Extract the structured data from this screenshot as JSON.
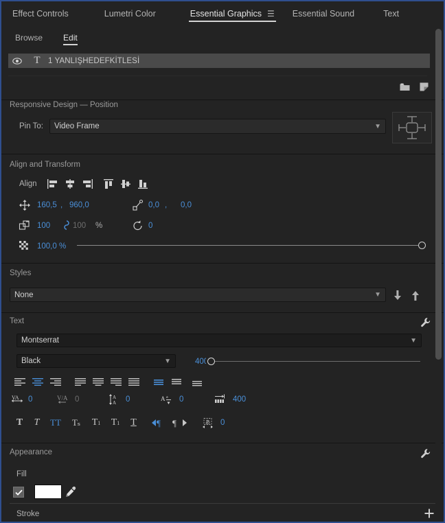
{
  "window": {
    "title": "Essential Graphics"
  },
  "tabs": [
    {
      "label": "Effect Controls",
      "active": false
    },
    {
      "label": "Lumetri Color",
      "active": false
    },
    {
      "label": "Essential Graphics",
      "active": true
    },
    {
      "label": "Essential Sound",
      "active": false
    },
    {
      "label": "Text",
      "active": false
    }
  ],
  "subtabs": [
    {
      "label": "Browse",
      "active": false
    },
    {
      "label": "Edit",
      "active": true
    }
  ],
  "layer": {
    "name": "1 YANLIŞHEDEFKİTLESİ",
    "visibility_icon": "eye-icon",
    "type_icon": "text-layer-icon"
  },
  "layer_toolbar": {
    "folder_icon": "new-folder-icon",
    "new_layer_icon": "new-layer-icon"
  },
  "responsive": {
    "title": "Responsive Design — Position",
    "pin_label": "Pin To:",
    "pin_value": "Video Frame",
    "pin_options": [
      "Video Frame"
    ]
  },
  "align_transform": {
    "title": "Align and Transform",
    "align_label": "Align",
    "align_buttons": [
      "align-left-icon",
      "align-center-horizontal-icon",
      "align-right-icon",
      "align-top-icon",
      "align-center-vertical-icon",
      "align-bottom-icon"
    ],
    "position": {
      "icon": "position-icon",
      "x": "160,5",
      "sep": ",",
      "y": "960,0"
    },
    "anchor": {
      "icon": "anchor-point-icon",
      "x": "0,0",
      "sep": ",",
      "y": "0,0"
    },
    "scale": {
      "icon": "scale-icon",
      "w": "100",
      "h": "100",
      "unit": "%",
      "link_icon": "link-icon"
    },
    "rotation": {
      "icon": "rotation-icon",
      "value": "0"
    },
    "opacity": {
      "icon": "opacity-icon",
      "value": "100,0 %",
      "slider_percent": 100
    }
  },
  "styles": {
    "title": "Styles",
    "value": "None",
    "options": [
      "None"
    ],
    "push_icon": "arrow-down-icon",
    "pull_icon": "arrow-up-icon"
  },
  "text": {
    "title": "Text",
    "settings_icon": "wrench-icon",
    "font_family": "Montserrat",
    "font_style": "Black",
    "font_size": "400",
    "paragraph_align": [
      {
        "icon": "align-text-left-icon",
        "active": false
      },
      {
        "icon": "align-text-center-icon",
        "active": true
      },
      {
        "icon": "align-text-right-icon",
        "active": false
      },
      {
        "icon": "justify-last-left-icon",
        "active": false
      },
      {
        "icon": "justify-last-center-icon",
        "active": false
      },
      {
        "icon": "justify-last-right-icon",
        "active": false
      },
      {
        "icon": "justify-all-icon",
        "active": false
      },
      {
        "icon": "align-vertical-center-icon",
        "active": true
      },
      {
        "icon": "align-vertical-top-icon",
        "active": false
      },
      {
        "icon": "align-vertical-bottom-icon",
        "active": false
      }
    ],
    "metrics": [
      {
        "icon": "tracking-icon",
        "value": "0",
        "dim": false
      },
      {
        "icon": "kerning-icon",
        "value": "0",
        "dim": true
      },
      {
        "icon": "leading-icon",
        "value": "0",
        "dim": false
      },
      {
        "icon": "baseline-shift-icon",
        "value": "0",
        "dim": false
      },
      {
        "icon": "paragraph-width-icon",
        "value": "400",
        "dim": false
      }
    ],
    "style_buttons": [
      {
        "icon": "faux-bold-icon",
        "label": "T",
        "active": false
      },
      {
        "icon": "faux-italic-icon",
        "label": "T",
        "active": false
      },
      {
        "icon": "all-caps-icon",
        "label": "TT",
        "active": true
      },
      {
        "icon": "small-caps-icon",
        "label": "TT",
        "active": false
      },
      {
        "icon": "superscript-icon",
        "label": "T",
        "active": false
      },
      {
        "icon": "subscript-icon",
        "label": "T",
        "active": false
      },
      {
        "icon": "underline-icon",
        "label": "T",
        "active": false
      },
      {
        "icon": "direction-ltr-icon",
        "label": "",
        "active": true
      },
      {
        "icon": "direction-rtl-icon",
        "label": "",
        "active": false
      },
      {
        "icon": "tsume-icon",
        "label": "",
        "active": false
      }
    ],
    "tsume_value": "0"
  },
  "appearance": {
    "title": "Appearance",
    "settings_icon": "wrench-icon",
    "fill": {
      "label": "Fill",
      "enabled": true,
      "color": "#ffffff",
      "eyedropper_icon": "eyedropper-icon"
    },
    "stroke": {
      "label": "Stroke",
      "add_icon": "plus-icon"
    }
  },
  "colors": {
    "panel_bg": "#232323",
    "accent_blue": "#4a8fd8",
    "selection": "#4a4a4a",
    "border": "#2f4f8f"
  }
}
